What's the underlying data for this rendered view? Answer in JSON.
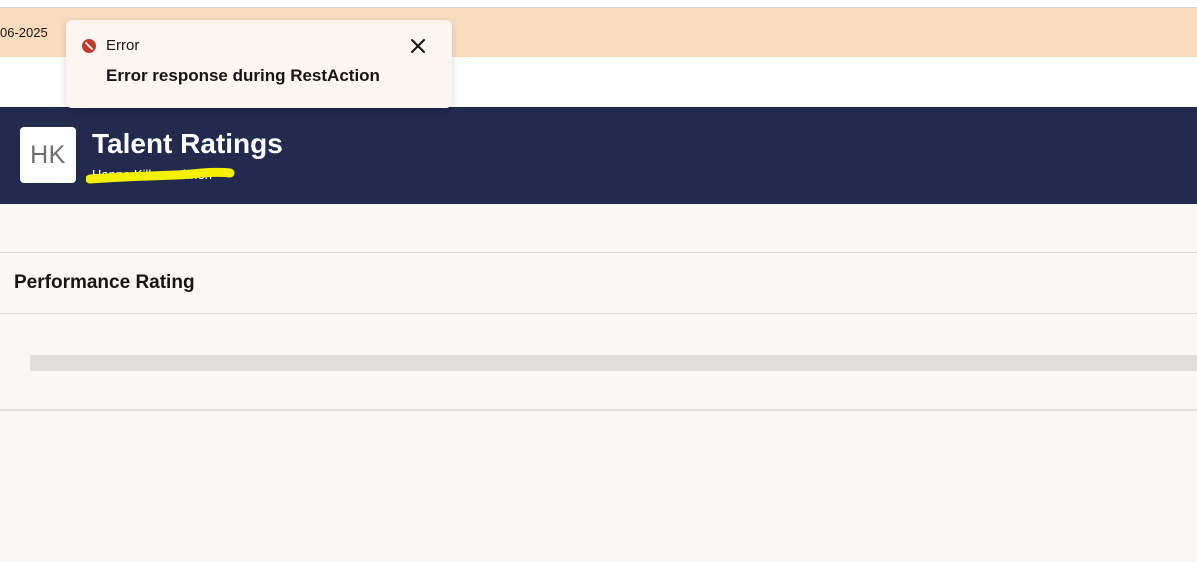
{
  "banner": {
    "date_text": "06-2025",
    "color": "#f9dcbe"
  },
  "header": {
    "avatar_initials": "HK",
    "title": "Talent Ratings",
    "subtitle": "Hanna Kilkenashnen",
    "background": "#222a4e",
    "redaction_color": "#f4f000"
  },
  "section": {
    "title": "Performance Rating"
  },
  "toast": {
    "type_label": "Error",
    "message": "Error response during RestAction",
    "icon": "error-icon",
    "close_icon": "close-icon",
    "error_color": "#c23a2b"
  }
}
